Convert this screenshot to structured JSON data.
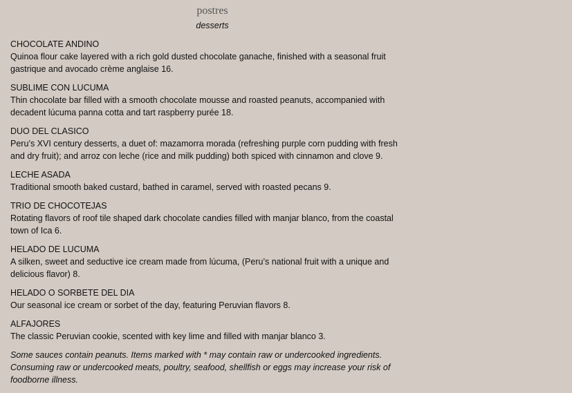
{
  "header": {
    "title": "postres",
    "subtitle": "desserts"
  },
  "items": [
    {
      "name": "CHOCOLATE ANDINO",
      "description": "Quinoa flour cake layered with a rich gold dusted chocolate ganache, finished with a seasonal fruit gastrique and avocado crème anglaise 16."
    },
    {
      "name": "SUBLIME CON LUCUMA",
      "description": "Thin chocolate bar filled with a smooth chocolate mousse and roasted peanuts, accompanied with decadent lúcuma panna cotta and tart raspberry purée 18."
    },
    {
      "name": "DUO DEL CLASICO",
      "description": "Peru’s XVI century desserts, a duet of: mazamorra morada (refreshing purple corn pudding with fresh and dry fruit); and arroz con leche (rice and milk pudding) both spiced with cinnamon and clove 9."
    },
    {
      "name": "LECHE ASADA",
      "description": "Traditional smooth baked custard, bathed in caramel, served with roasted pecans 9."
    },
    {
      "name": "TRIO DE CHOCOTEJAS",
      "description": "Rotating flavors of roof tile shaped dark chocolate candies filled with manjar blanco, from the coastal town of Ica 6."
    },
    {
      "name": "HELADO DE LUCUMA",
      "description": "A silken, sweet and seductive ice cream made from lúcuma, (Peru’s national fruit with a unique and delicious flavor) 8."
    },
    {
      "name": "HELADO O SORBETE DEL DIA",
      "description": "Our seasonal ice cream or sorbet of the day, featuring Peruvian flavors 8."
    },
    {
      "name": "ALFAJORES",
      "description": "The classic Peruvian cookie, scented with key lime and filled with manjar blanco 3."
    }
  ],
  "disclaimer": "Some sauces contain peanuts. Items marked with * may contain raw or undercooked ingredients. Consuming raw or undercooked meats, poultry, seafood, shellfish or eggs may increase your risk of foodborne illness."
}
